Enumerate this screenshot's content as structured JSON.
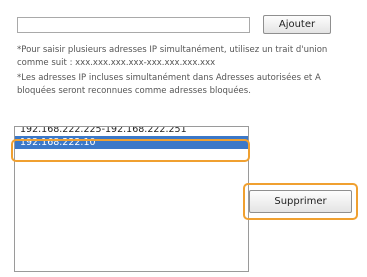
{
  "form": {
    "ip_input_value": "",
    "add_button": "Ajouter",
    "notes": [
      "*Pour saisir plusieurs adresses IP simultanément, utilisez un trait d'union",
      "comme suit : xxx.xxx.xxx.xxx-xxx.xxx.xxx.xxx",
      "*Les adresses IP incluses simultanément dans Adresses autorisées et A",
      "bloquées seront reconnues comme adresses bloquées."
    ],
    "list_items": [
      "192.168.222.225-192.168.222.251",
      "192.168.222.10"
    ],
    "selected_index": 1,
    "delete_button": "Supprimer"
  },
  "colors": {
    "selection": "#3b78c8",
    "highlight": "#f0a030"
  }
}
